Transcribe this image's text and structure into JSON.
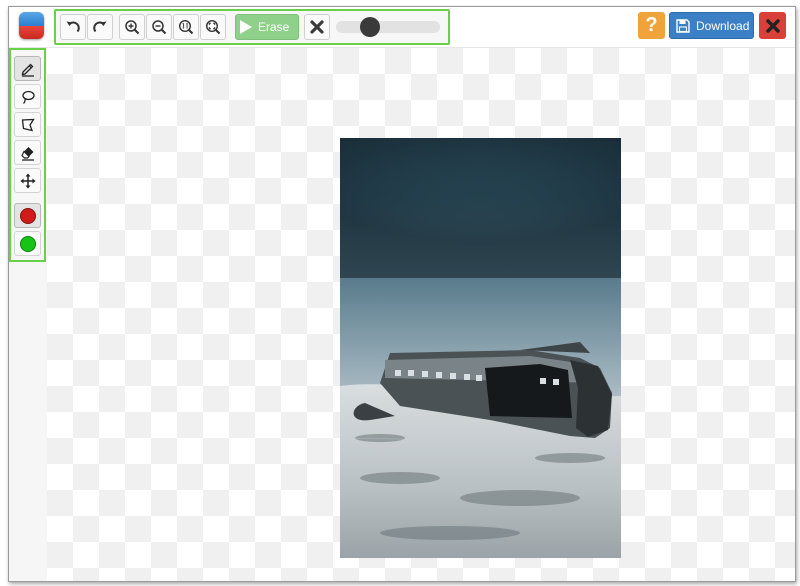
{
  "app": {
    "logo_icon": "app-logo-icon"
  },
  "toolbar": {
    "erase_label": "Erase",
    "slider_value_percent": 33,
    "colors": {
      "border_highlight": "#6ad04a",
      "erase_bg": "#8fd08a"
    }
  },
  "header": {
    "help_label": "?",
    "download_label": "Download",
    "colors": {
      "help": "#f0a33a",
      "download": "#3b7fc4",
      "close": "#d9403a"
    }
  },
  "sidebar": {
    "tools": [
      "keep-brush-icon",
      "lasso-icon",
      "polygon-icon",
      "eraser-icon",
      "move-icon"
    ],
    "colors": [
      {
        "name": "red",
        "hex": "#d11a1a"
      },
      {
        "name": "green",
        "hex": "#16c416"
      }
    ]
  }
}
